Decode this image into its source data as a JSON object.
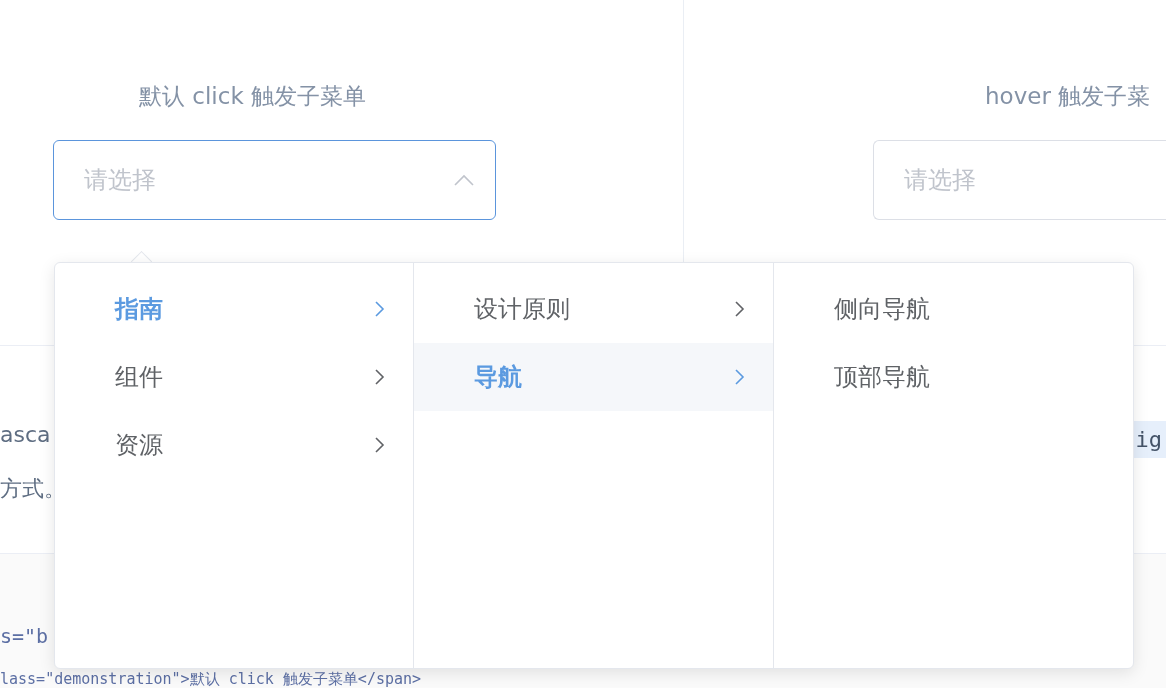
{
  "demos": [
    {
      "label": "默认 click 触发子菜单",
      "select": {
        "placeholder": "请选择",
        "expanded": true
      }
    },
    {
      "label": "hover 触发子菜",
      "select": {
        "placeholder": "请选择",
        "expanded": false
      }
    }
  ],
  "description": {
    "lines": [
      "asca",
      "方式。"
    ],
    "inline_code": "ig"
  },
  "code": {
    "lines": [
      "s=\"b",
      "lass=\"demonstration\">默认 click 触发子菜单</span>"
    ]
  },
  "cascader_menu": {
    "columns": [
      {
        "items": [
          {
            "label": "指南",
            "selected": true,
            "has_children": true
          },
          {
            "label": "组件",
            "selected": false,
            "has_children": true
          },
          {
            "label": "资源",
            "selected": false,
            "has_children": true
          }
        ]
      },
      {
        "items": [
          {
            "label": "设计原则",
            "selected": false,
            "has_children": true
          },
          {
            "label": "导航",
            "selected": true,
            "has_children": true
          }
        ]
      },
      {
        "items": [
          {
            "label": "侧向导航",
            "selected": false,
            "has_children": false
          },
          {
            "label": "顶部导航",
            "selected": false,
            "has_children": false
          }
        ]
      }
    ]
  }
}
